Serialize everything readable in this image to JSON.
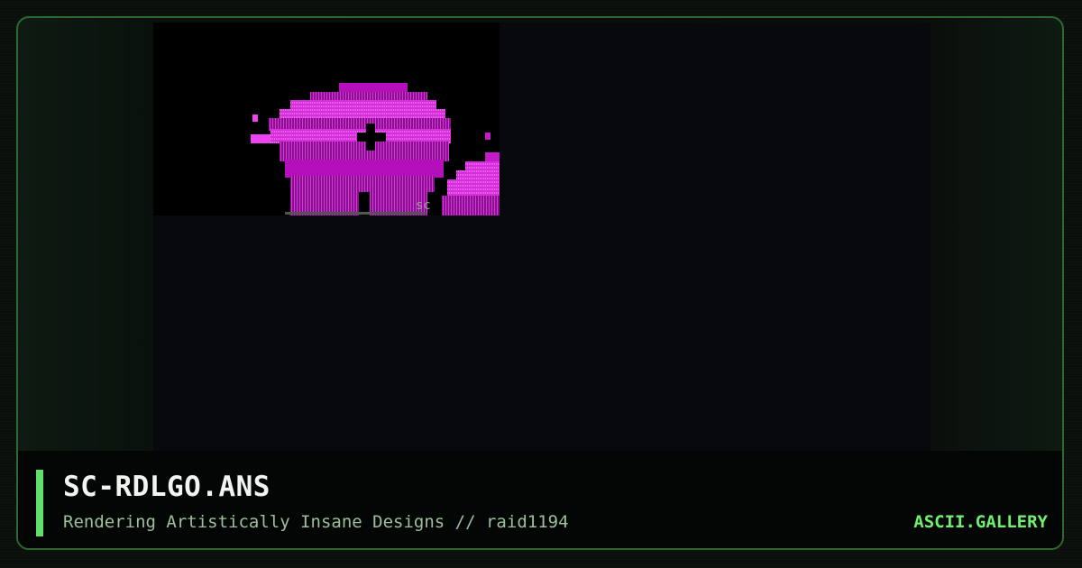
{
  "artwork": {
    "title": "SC-RDLGO.ANS",
    "subtitle": "Rendering Artistically Insane Designs // raid1194",
    "signature": "sc"
  },
  "brand": "ASCII.GALLERY",
  "colors": {
    "accent": "#5fe06a",
    "brand": "#6ff071",
    "magenta": "#c21bc7",
    "magenta_light": "#ee44f0",
    "frame_border": "#2c6a30"
  }
}
